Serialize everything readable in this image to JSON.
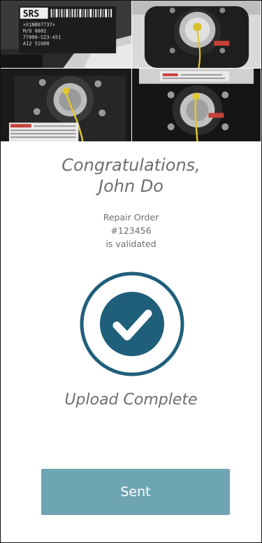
{
  "photos": {
    "label_text": {
      "brand": "SRS",
      "line1": "×X1NB07737×",
      "line2": "M/D 0802",
      "line3": "77800-SZ3-A51",
      "line4": "A12       51088"
    }
  },
  "confirmation": {
    "greeting_line1": "Congratulations,",
    "greeting_line2": "John Do",
    "order_label": "Repair Order",
    "order_number": "#123456",
    "order_status": "is validated",
    "upload_status": "Upload Complete"
  },
  "actions": {
    "sent_label": "Sent"
  },
  "colors": {
    "accent": "#1f5f7a",
    "button": "#6ea5b3",
    "text": "#6d6e71"
  }
}
